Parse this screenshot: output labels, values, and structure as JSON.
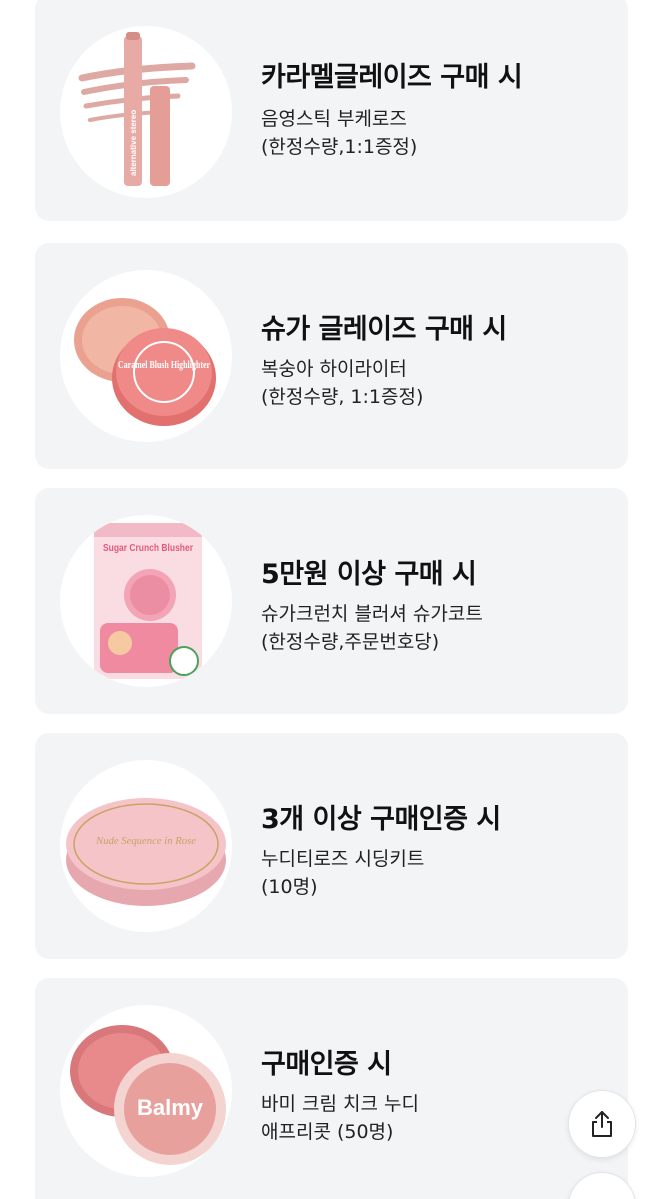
{
  "cards": [
    {
      "title": "카라멜글레이즈 구매 시",
      "line1": "음영스틱 부케로즈",
      "line2": "(한정수량,1:1증정)",
      "image_icon": "pink-shadow-stick-product",
      "image_text": "alternative stereo"
    },
    {
      "title": "슈가 글레이즈 구매 시",
      "line1": "복숭아 하이라이터",
      "line2": "(한정수량, 1:1증정)",
      "image_icon": "peach-highlighter-compact-product",
      "image_text": "Caramel Blush Highlighter"
    },
    {
      "title": "5만원 이상 구매 시",
      "line1": "슈가크런치 블러셔 슈가코트",
      "line2": "(한정수량,주문번호당)",
      "image_icon": "sugar-crunch-blusher-package-product",
      "image_text": "Sugar Crunch Blusher"
    },
    {
      "title": "3개 이상 구매인증 시",
      "line1": "누디티로즈 시딩키트",
      "line2": "(10명)",
      "image_icon": "nude-rose-seeding-kit-box-product",
      "image_text": "Nude Sequence in Rose"
    },
    {
      "title": "구매인증 시",
      "line1": "바미 크림 치크 누디",
      "line2": "애프리콧 (50명)",
      "image_icon": "balmy-cream-cheek-product",
      "image_text": "Balmy"
    }
  ],
  "share": {
    "icon": "share-icon"
  },
  "colors": {
    "card_bg": "#f3f4f6",
    "title": "#111111",
    "desc": "#222222"
  }
}
